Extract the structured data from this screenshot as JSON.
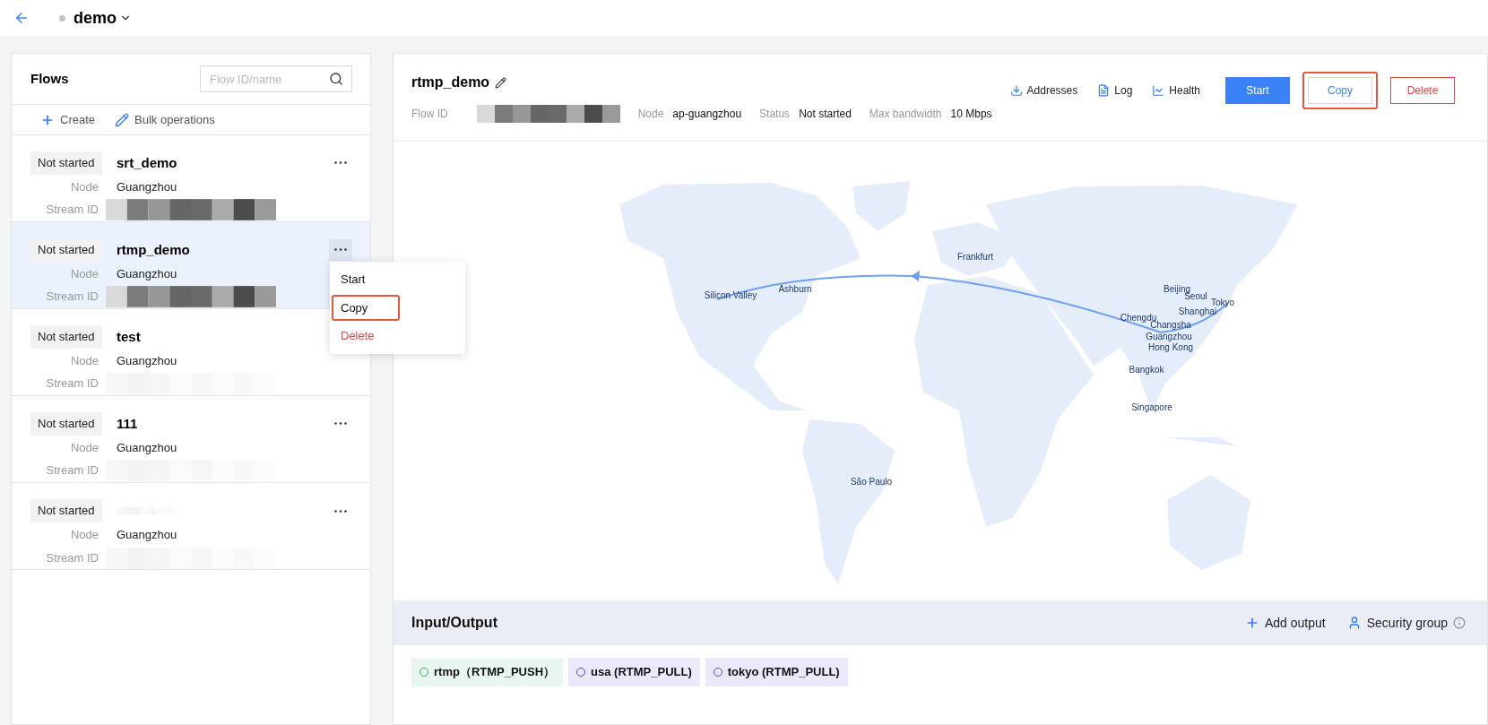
{
  "topbar": {
    "title": "demo"
  },
  "flows_panel": {
    "title": "Flows",
    "search": {
      "placeholder": "Flow ID/name"
    },
    "actions": [
      {
        "label": "Create"
      },
      {
        "label": "Bulk operations"
      }
    ],
    "flows": [
      {
        "status": "Not started",
        "name": "srt_demo",
        "node_label": "Node",
        "node": "Guangzhou",
        "stream_label": "Stream ID",
        "selected": false,
        "menu_open": false
      },
      {
        "status": "Not started",
        "name": "rtmp_demo",
        "node_label": "Node",
        "node": "Guangzhou",
        "stream_label": "Stream ID",
        "selected": true,
        "menu_open": true
      },
      {
        "status": "Not started",
        "name": "test",
        "node_label": "Node",
        "node": "Guangzhou",
        "stream_label": "Stream ID",
        "selected": false,
        "menu_open": false
      },
      {
        "status": "Not started",
        "name": "111",
        "node_label": "Node",
        "node": "Guangzhou",
        "stream_label": "Stream ID",
        "selected": false,
        "menu_open": false
      },
      {
        "status": "Not started",
        "node_label": "Node",
        "node": "Guangzhou",
        "stream_label": "Stream ID",
        "selected": false,
        "menu_open": false
      }
    ],
    "context_menu": [
      {
        "label": "Start",
        "kind": "normal",
        "highlighted": false
      },
      {
        "label": "Copy",
        "kind": "normal",
        "highlighted": true
      },
      {
        "label": "Delete",
        "kind": "danger",
        "highlighted": false
      }
    ]
  },
  "detail": {
    "title": "rtmp_demo",
    "fields": [
      {
        "label": "Flow ID",
        "kind": "redacted"
      },
      {
        "label": "Node",
        "value": "ap-guangzhou",
        "kind": "text"
      },
      {
        "label": "Status",
        "value": "Not started",
        "kind": "text"
      },
      {
        "label": "Max bandwidth",
        "value": "10 Mbps",
        "kind": "text"
      }
    ],
    "links": [
      {
        "label": "Addresses"
      },
      {
        "label": "Log"
      },
      {
        "label": "Health"
      }
    ],
    "buttons": [
      {
        "label": "Start",
        "kind": "primary",
        "highlighted": false
      },
      {
        "label": "Copy",
        "kind": "default",
        "highlighted": true
      },
      {
        "label": "Delete",
        "kind": "danger",
        "highlighted": false
      }
    ],
    "map": {
      "cities": [
        "Frankfurt",
        "Silicon Valley",
        "Ashburn",
        "Beijing",
        "Seoul",
        "Tokyo",
        "Chengdu",
        "Shanghai",
        "Changsha",
        "Guangzhou",
        "Hong Kong",
        "Bangkok",
        "Singapore",
        "São Paulo"
      ]
    },
    "io": {
      "title": "Input/Output",
      "actions": [
        {
          "label": "Add output"
        },
        {
          "label": "Security group"
        }
      ],
      "tags": [
        {
          "label": "rtmp（RTMP_PUSH）",
          "kind": "input"
        },
        {
          "label": "usa (RTMP_PULL)",
          "kind": "output"
        },
        {
          "label": "tokyo (RTMP_PULL)",
          "kind": "output"
        }
      ]
    }
  }
}
